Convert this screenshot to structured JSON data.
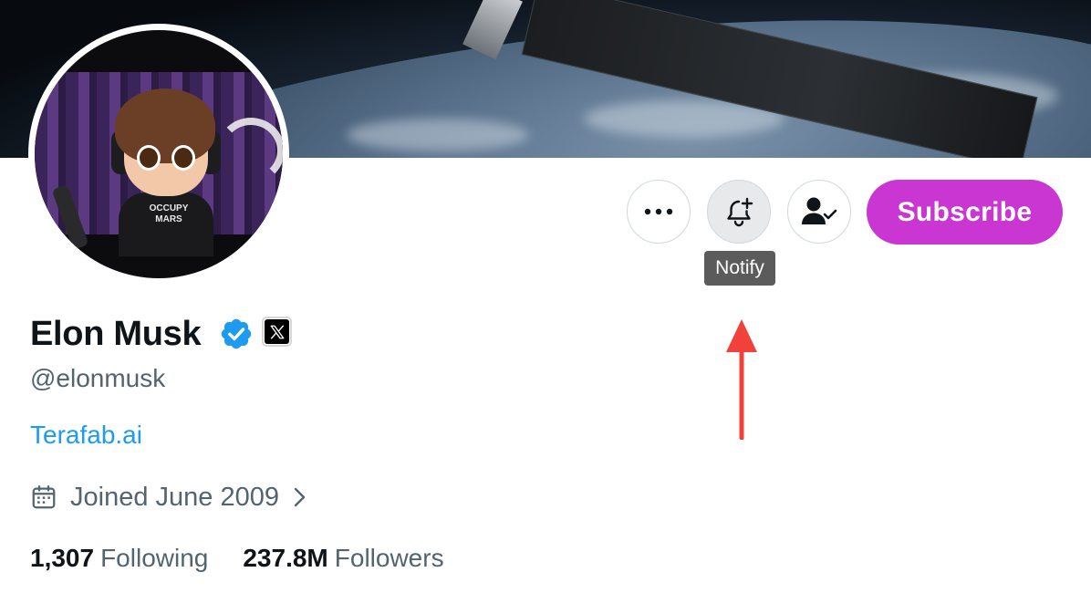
{
  "profile": {
    "name": "Elon Musk",
    "handle": "@elonmusk",
    "website": "Terafab.ai",
    "joined": "Joined June 2009",
    "following_count": "1,307",
    "following_label": "Following",
    "followers_count": "237.8M",
    "followers_label": "Followers",
    "avatar_shirt_text": "OCCUPY MARS"
  },
  "actions": {
    "more_icon": "more-horizontal-icon",
    "notify_icon": "bell-plus-icon",
    "following_icon": "person-check-icon",
    "subscribe_label": "Subscribe",
    "tooltip": "Notify"
  },
  "icons": {
    "verified": "verified-badge-icon",
    "affiliate": "x-logo-icon",
    "calendar": "calendar-icon",
    "chevron": "chevron-right-icon",
    "annotation": "red-arrow-icon"
  },
  "colors": {
    "subscribe": "#c936d1",
    "link": "#1d9bf0",
    "verified": "#1d9bf0",
    "arrow": "#f0423a",
    "secondary_text": "#536471"
  }
}
